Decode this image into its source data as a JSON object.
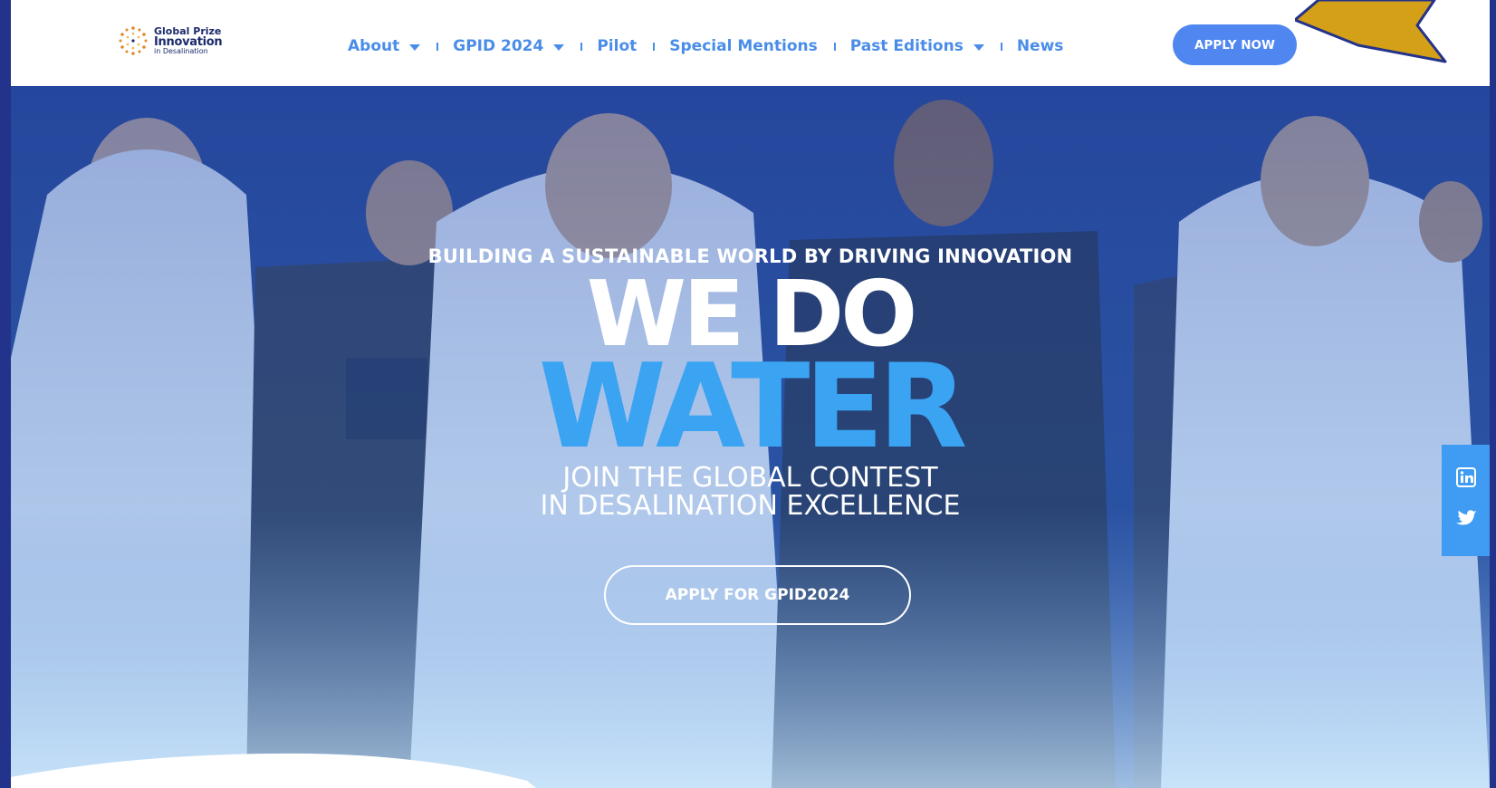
{
  "logo": {
    "line1": "Global Prize",
    "line2": "Innovation",
    "line3": "in Desalination"
  },
  "nav": {
    "items": [
      {
        "label": "About",
        "dropdown": true
      },
      {
        "label": "GPID 2024",
        "dropdown": true
      },
      {
        "label": "Pilot",
        "dropdown": false
      },
      {
        "label": "Special Mentions",
        "dropdown": false
      },
      {
        "label": "Past Editions",
        "dropdown": true
      },
      {
        "label": "News",
        "dropdown": false
      }
    ]
  },
  "header": {
    "apply_label": "APPLY NOW"
  },
  "hero": {
    "tagline": "BUILDING A SUSTAINABLE WORLD BY DRIVING INNOVATION",
    "headline_1": "WE DO",
    "headline_2": "WATER",
    "subtitle_1": "JOIN THE GLOBAL CONTEST",
    "subtitle_2": "IN DESALINATION EXCELLENCE",
    "cta_label": "APPLY FOR GPID2024"
  },
  "social": {
    "icons": [
      "linkedin-icon",
      "twitter-icon"
    ]
  },
  "colors": {
    "page_border": "#23328a",
    "nav_text": "#4a8de8",
    "primary_button": "#4f86f0",
    "water_blue": "#3aa4f2",
    "social_bar": "#3f9cf2",
    "annotation_arrow": "#d4a017"
  }
}
